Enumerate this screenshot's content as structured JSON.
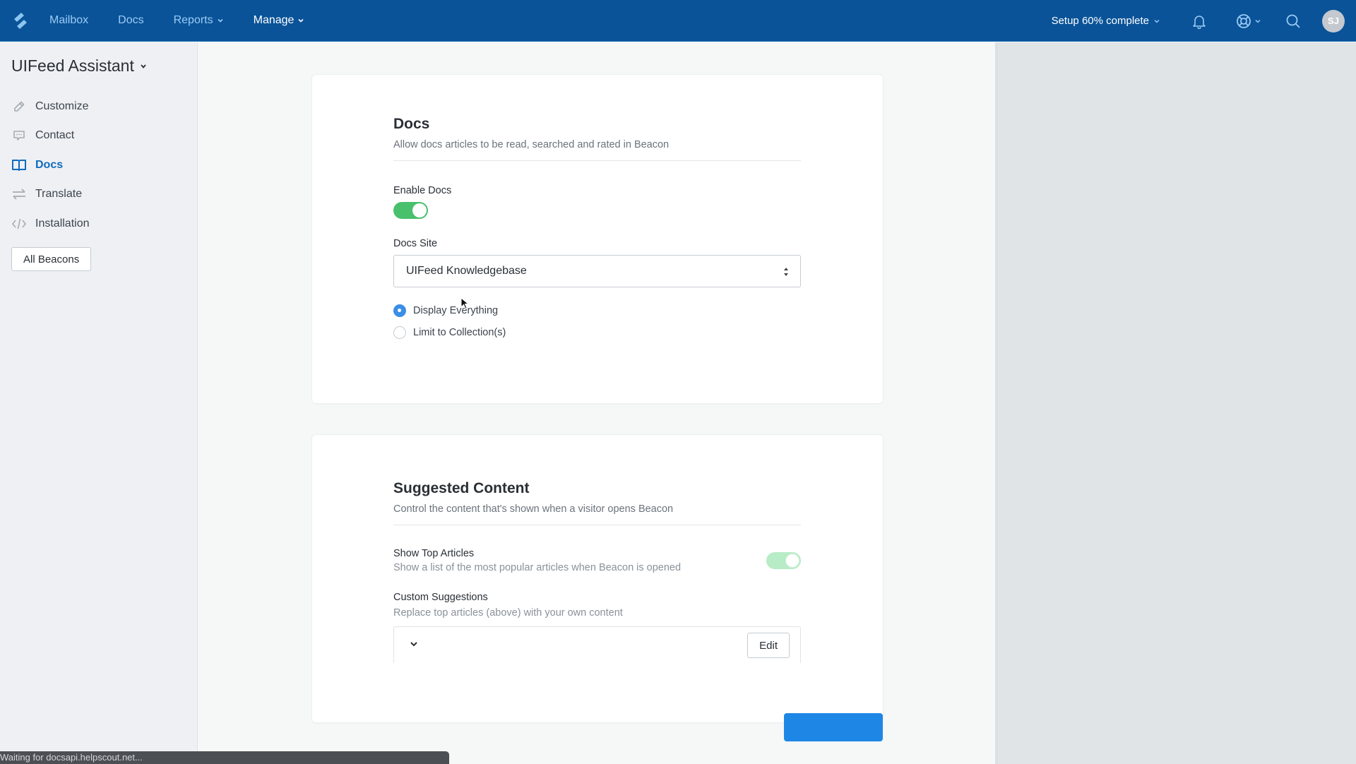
{
  "topnav": {
    "items": [
      {
        "label": "Mailbox",
        "has_dropdown": false,
        "active": false
      },
      {
        "label": "Docs",
        "has_dropdown": false,
        "active": false
      },
      {
        "label": "Reports",
        "has_dropdown": true,
        "active": false
      },
      {
        "label": "Manage",
        "has_dropdown": true,
        "active": true
      }
    ],
    "setup_label": "Setup 60% complete",
    "setup_progress_percent": 60,
    "avatar_initials": "SJ",
    "icons": [
      "logo-icon",
      "bell-icon",
      "help-lifebuoy-icon",
      "search-icon"
    ],
    "colors": {
      "bar": "#0a5398",
      "inactive_link": "#9bcbf5",
      "active_link": "#ffffff"
    }
  },
  "sidebar": {
    "title": "UIFeed Assistant",
    "items": [
      {
        "label": "Customize",
        "icon": "pencil-icon",
        "active": false
      },
      {
        "label": "Contact",
        "icon": "chat-bubble-icon",
        "active": false
      },
      {
        "label": "Docs",
        "icon": "book-icon",
        "active": true
      },
      {
        "label": "Translate",
        "icon": "arrows-exchange-icon",
        "active": false
      },
      {
        "label": "Installation",
        "icon": "code-icon",
        "active": false
      }
    ],
    "all_beacons_label": "All Beacons",
    "colors": {
      "active": "#0f6cbd"
    }
  },
  "docs_card": {
    "title": "Docs",
    "subtitle": "Allow docs articles to be read, searched and rated in Beacon",
    "enable_label": "Enable Docs",
    "enable_on": true,
    "site_label": "Docs Site",
    "site_value": "UIFeed Knowledgebase",
    "radio_options": [
      {
        "label": "Display Everything",
        "checked": true
      },
      {
        "label": "Limit to Collection(s)",
        "checked": false
      }
    ]
  },
  "suggested_card": {
    "title": "Suggested Content",
    "subtitle": "Control the content that's shown when a visitor opens Beacon",
    "top_articles_label": "Show Top Articles",
    "top_articles_desc": "Show a list of the most popular articles when Beacon is opened",
    "top_articles_on": true,
    "custom_label": "Custom Suggestions",
    "custom_desc": "Replace top articles (above) with your own content",
    "edit_label": "Edit"
  },
  "statusbar": {
    "text": "Waiting for docsapi.helpscout.net..."
  },
  "colors": {
    "toggle_on": "#48c06c",
    "radio_checked": "#3a8ee6",
    "primary_button": "#1e87e6"
  }
}
